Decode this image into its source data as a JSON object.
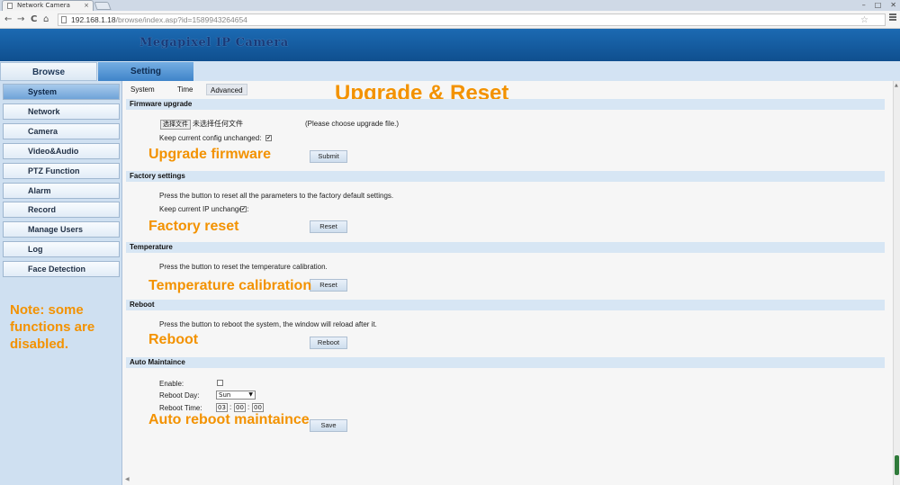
{
  "browser": {
    "tab_title": "Network Camera",
    "tab_close": "×",
    "url_host": "192.168.1.18",
    "url_path": "/browse/index.asp?id=1589943264654",
    "back": "←",
    "forward": "→",
    "reload": "C",
    "home": "⌂",
    "star": "☆",
    "win_min": "–",
    "win_max": "□",
    "win_close": "✕"
  },
  "app": {
    "title": "Megapixel IP Camera"
  },
  "mode_tabs": [
    "Browse",
    "Setting"
  ],
  "sidebar": {
    "items": [
      "System",
      "Network",
      "Camera",
      "Video&Audio",
      "PTZ Function",
      "Alarm",
      "Record",
      "Manage Users",
      "Log",
      "Face Detection"
    ],
    "note": "Note: some functions are disabled."
  },
  "subtabs": [
    "System",
    "Time",
    "Advanced"
  ],
  "annotations": {
    "page": "Upgrade & Reset",
    "upgrade": "Upgrade firmware",
    "factory": "Factory reset",
    "temperature": "Temperature calibration",
    "reboot": "Reboot",
    "auto": "Auto reboot maintaince"
  },
  "firmware": {
    "header": "Firmware upgrade",
    "choose_button": "选择文件",
    "no_file": "未选择任何文件",
    "hint": "(Please choose upgrade file.)",
    "keep_config": "Keep current config unchanged:",
    "keep_checked": "✔",
    "submit": "Submit"
  },
  "factory": {
    "header": "Factory settings",
    "desc": "Press the button to reset all the parameters to the factory default settings.",
    "keep_ip": "Keep current IP unchanged:",
    "keep_checked": "✔",
    "button": "Reset"
  },
  "temperature": {
    "header": "Temperature",
    "desc": "Press the button to reset the temperature calibration.",
    "button": "Reset"
  },
  "reboot": {
    "header": "Reboot",
    "desc": "Press the button to reboot the system, the window will reload after it.",
    "button": "Reboot"
  },
  "auto": {
    "header": "Auto Maintaince",
    "enable_label": "Enable:",
    "day_label": "Reboot Day:",
    "day_value": "Sun",
    "time_label": "Reboot Time:",
    "hour": "03",
    "minute": "00",
    "second": "00",
    "sep": ":",
    "button": "Save"
  }
}
